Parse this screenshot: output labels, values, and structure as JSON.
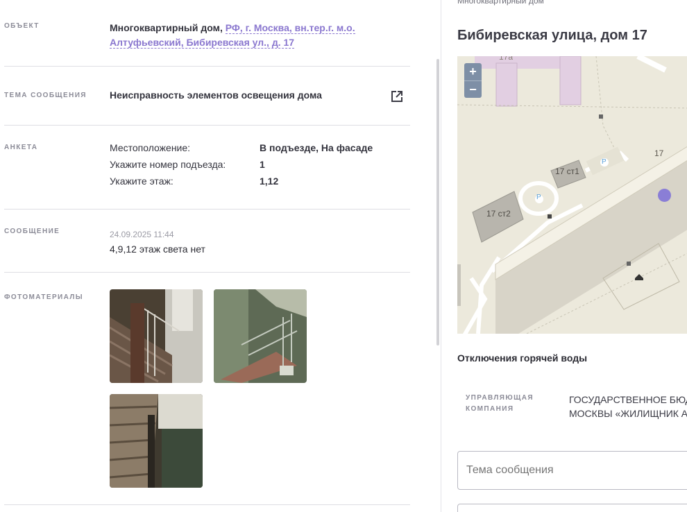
{
  "left": {
    "object": {
      "label": "Объект",
      "type_text": "Многоквартирный дом,",
      "address_line1": "РФ, г. Москва, вн.тер.г. м.о.",
      "address_line2": "Алтуфьевский, Бибиревская ул., д. 17"
    },
    "topic": {
      "label": "Тема сообщения",
      "value": "Неисправность элементов освещения дома",
      "icon": "open-in-new-icon"
    },
    "survey": {
      "label": "Анкета",
      "rows": [
        {
          "key": "Местоположение:",
          "value": "В подъезде, На фасаде"
        },
        {
          "key": "Укажите номер подъезда:",
          "value": "1"
        },
        {
          "key": "Укажите этаж:",
          "value": "1,12"
        }
      ]
    },
    "message": {
      "label": "Сообщение",
      "date": "24.09.2025 11:44",
      "text": "4,9,12 этаж света нет"
    },
    "photos": {
      "label": "Фотоматериалы",
      "count": 3
    }
  },
  "right": {
    "building_type": "Многоквартирный дом",
    "title": "Бибиревская улица, дом 17",
    "map": {
      "zoom_in": "+",
      "zoom_out": "−",
      "labels": {
        "b17a": "17а",
        "b17": "17",
        "b17st1": "17 ст1",
        "b17st2": "17 ст2",
        "parking1": "P",
        "parking2": "P"
      },
      "marker_color": "#8a7ed6"
    },
    "hot_water": "Отключения горячей воды",
    "management": {
      "label_line1": "Управляющая",
      "label_line2": "компания",
      "value_line1": "ГОСУДАРСТВЕННОЕ БЮДЖ",
      "value_line2": "МОСКВЫ «ЖИЛИЩНИК АЛ"
    },
    "topic_input_placeholder": "Тема сообщения"
  },
  "colors": {
    "accent": "#8a77cf",
    "label": "#8b8b97",
    "map_bg": "#ece9dc"
  }
}
